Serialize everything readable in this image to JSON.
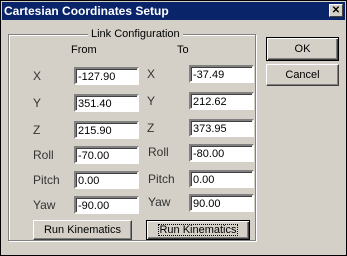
{
  "window": {
    "title": "Cartesian Coordinates Setup",
    "close_glyph": "✕"
  },
  "group": {
    "title": "Link Configuration"
  },
  "columns": {
    "from": "From",
    "to": "To"
  },
  "rows": [
    {
      "label": "X",
      "from": "-127.90",
      "to": "-37.49"
    },
    {
      "label": "Y",
      "from": "351.40",
      "to": "212.62"
    },
    {
      "label": "Z",
      "from": "215.90",
      "to": "373.95"
    },
    {
      "label": "Roll",
      "from": "-70.00",
      "to": "-80.00"
    },
    {
      "label": "Pitch",
      "from": "0.00",
      "to": "0.00"
    },
    {
      "label": "Yaw",
      "from": "-90.00",
      "to": "90.00"
    }
  ],
  "buttons": {
    "ok": "OK",
    "cancel": "Cancel",
    "run_kinematics_from": "Run Kinematics",
    "run_kinematics_to": "Run Kinematics"
  }
}
